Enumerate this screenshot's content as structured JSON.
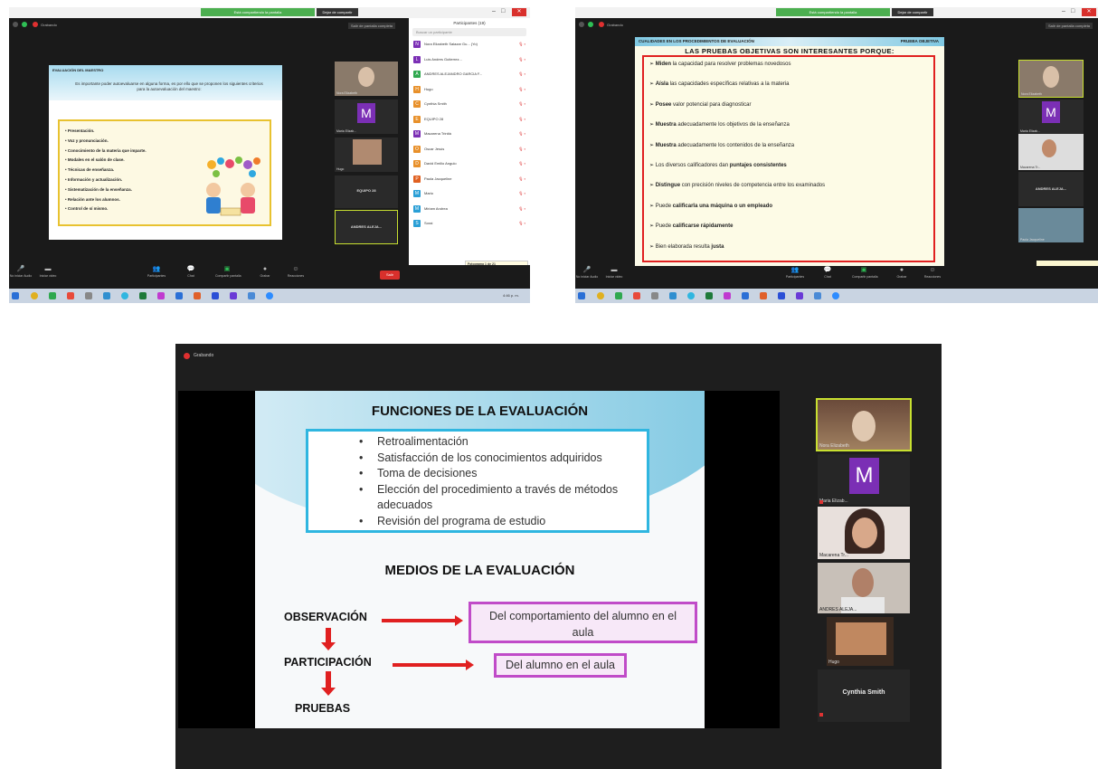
{
  "screen1": {
    "banner": "Está compartiendo la pantalla",
    "stop_share": "Dejar de compartir",
    "recording": "Grabando",
    "exit_fullscreen": "Salir de pantalla completa",
    "slide": {
      "header": "EVALUACIÓN DEL MAESTRO",
      "intro": "Es importante poder autoevaluarse en alguna forma, es por ello que se proponen los siguientes criterios para la autoevaluación del maestro:",
      "items": [
        "Presentación.",
        "Voz y pronunciación.",
        "Conocimiento de la materia que imparte.",
        "Modales en el salón de clase.",
        "Técnicas de enseñanza.",
        "Información y actualización.",
        "Sistematización de la enseñanza.",
        "Relación ante los alumnos.",
        "Control de sí mismo."
      ]
    },
    "thumbs": {
      "t1": "Nora Elizabeth",
      "t2": "Maria Elizab...",
      "t3": "Hugo",
      "t4": "EQUIPO 28",
      "t5": "ANDRES ALEJA..."
    },
    "participants": {
      "title": "Participantes (19)",
      "search_placeholder": "Buscar un participante",
      "rows": [
        {
          "name": "Nora Elizabeth Salazar Gu... (Yo)",
          "color": "#7b2fb5"
        },
        {
          "name": "Luis Andres Gutierrez...",
          "color": "#7b2fb5"
        },
        {
          "name": "ANDRES ALEJANDRO GARCIA F...",
          "color": "#2fa84f"
        },
        {
          "name": "Hugo",
          "color": "#e8902a"
        },
        {
          "name": "Cynthia Smith",
          "color": "#e8902a"
        },
        {
          "name": "EQUIPO 28",
          "color": "#e8902a"
        },
        {
          "name": "Macarena Trinitá",
          "color": "#7b2fb5"
        },
        {
          "name": "Oscar Jesús",
          "color": "#e8902a"
        },
        {
          "name": "David Emilio Angulo",
          "color": "#e8902a"
        },
        {
          "name": "Paola Jacqueline",
          "color": "#e06020"
        },
        {
          "name": "Mario",
          "color": "#2a9fd6"
        },
        {
          "name": "Miriam Andrea",
          "color": "#2a9fd6"
        },
        {
          "name": "Sorai",
          "color": "#2a9fd6"
        }
      ],
      "invite": "Invitar",
      "mute_all": "Silenciar todo",
      "tooltip_title": "Fotograma 1 de 21",
      "tooltip": "Recuerde, no compartir demasiado para acceder al espacio disponible."
    },
    "toolbar": {
      "audio": "No iniciar Audio",
      "video": "Iniciar video",
      "participants": "Participantes",
      "chat": "Chat",
      "share": "Compartir pantalla",
      "record": "Grabar",
      "reactions": "Reacciones",
      "end": "Salir"
    },
    "clock": "4:46 p. m."
  },
  "screen2": {
    "banner": "Está compartiendo la pantalla",
    "stop_share": "Dejar de compartir",
    "recording": "Grabando",
    "exit_fullscreen": "Salir de pantalla completa",
    "slide": {
      "header_left": "CUALIDADES EN LOS PROCEDIMIENTOS DE EVALUACIÓN",
      "header_right": "PRUEBA OBJETIVA",
      "subtitle": "LAS PRUEBAS OBJETIVAS SON INTERESANTES PORQUE:",
      "items": [
        {
          "b": "Miden",
          "t": " la capacidad para resolver problemas novedosos",
          "b2": ""
        },
        {
          "b": "Aísla",
          "t": " las capacidades específicas relativas a la materia",
          "b2": ""
        },
        {
          "b": "Posee",
          "t": " valor potencial para diagnosticar",
          "b2": ""
        },
        {
          "b": "Muestra",
          "t": " adecuadamente los objetivos de la enseñanza",
          "b2": ""
        },
        {
          "b": "Muestra",
          "t": " adecuadamente los contenidos de la enseñanza",
          "b2": ""
        },
        {
          "b": "",
          "t": "Los diversos calificadores dan ",
          "b2": "puntajes consistentes"
        },
        {
          "b": "Distingue",
          "t": " con precisión niveles de competencia entre los examinados",
          "b2": ""
        },
        {
          "b": "",
          "t": "Puede ",
          "b2": "calificarla una máquina o un empleado"
        },
        {
          "b": "",
          "t": "Puede ",
          "b2": "calificarse rápidamente"
        },
        {
          "b": "",
          "t": "Bien elaborada resulta ",
          "b2": "justa"
        }
      ]
    },
    "thumbs": {
      "t1": "Nora Elizabeth",
      "t2": "Maria Elizab...",
      "t3": "Macarena Tr...",
      "t4": "ANDRES ALEJA...",
      "t5": "Paola Jacqueline"
    },
    "toolbar": {
      "audio": "No iniciar Audio",
      "video": "Iniciar video",
      "participants": "Participantes",
      "chat": "Chat",
      "share": "Compartir pantalla",
      "record": "Grabar",
      "reactions": "Reacciones"
    }
  },
  "screen3": {
    "recording": "Grabando",
    "slide": {
      "title1": "FUNCIONES DE LA EVALUACIÓN",
      "functions": [
        "Retroalimentación",
        "Satisfacción de los conocimientos adquiridos",
        "Toma de decisiones",
        "Elección del procedimiento a través de métodos adecuados",
        "Revisión del programa de estudio"
      ],
      "title2": "MEDIOS DE LA EVALUACIÓN",
      "means": [
        "OBSERVACIÓN",
        "PARTICIPACIÓN",
        "PRUEBAS"
      ],
      "box1": "Del comportamiento del alumno en el aula",
      "box2": "Del alumno en el aula"
    },
    "thumbs": {
      "t1": "Nora Elizabeth",
      "t2_letter": "M",
      "t2": "Maria Elizab...",
      "t3": "Macarena Tr...",
      "t4": "ANDRES ALEJA...",
      "t5": "Hugo",
      "t6": "Cynthia Smith"
    }
  },
  "colors": {
    "window_bg": "#1a1a1a",
    "accent_green": "#4caf50",
    "end_red": "#d9302c",
    "yellow_border": "#e8c230",
    "blue_border": "#2fb6e0",
    "magenta_border": "#c04bc8",
    "arrow_red": "#e02020",
    "avatar_purple": "#7b2fb5"
  },
  "icon_letter_m": "M"
}
